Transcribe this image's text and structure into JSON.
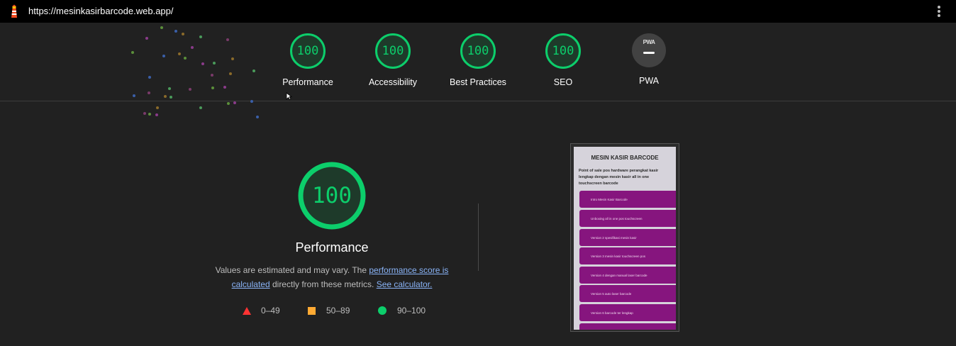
{
  "topbar": {
    "url": "https://mesinkasirbarcode.web.app/",
    "menu_icon": "kebab-menu-icon",
    "logo_icon": "lighthouse-icon"
  },
  "categories": [
    {
      "label": "Performance",
      "score": "100"
    },
    {
      "label": "Accessibility",
      "score": "100"
    },
    {
      "label": "Best Practices",
      "score": "100"
    },
    {
      "label": "SEO",
      "score": "100"
    },
    {
      "label": "PWA",
      "badge": "PWA"
    }
  ],
  "main": {
    "score": "100",
    "title": "Performance",
    "desc_prefix": "Values are estimated and may vary. The ",
    "desc_link1": "performance score is calculated",
    "desc_mid": " directly from these metrics. ",
    "desc_link2": "See calculator."
  },
  "legend": [
    {
      "range": "0–49",
      "shape": "triangle",
      "color": "#ff3333"
    },
    {
      "range": "50–89",
      "shape": "square",
      "color": "#ffaa33"
    },
    {
      "range": "90–100",
      "shape": "circle",
      "color": "#0cce6b"
    }
  ],
  "screenshot": {
    "title": "MESIN KASIR BARCODE",
    "subtitle": "Point of sale pos hardware perangkat kasir lengkap dengan mesin kasir all in one touchscreen barcode",
    "items": [
      "Intro Mesin Kasir Barcode",
      "Unboxing all in one pos touchscreen",
      "Version 2 spesifikasi mesin kasir",
      "Version 3 mesin kasir touchscreen pos",
      "Version 4 dengan manual laser barcode",
      "Version 5 auto laser barcode",
      "Version 6 barcode ter lengkap"
    ]
  },
  "colors": {
    "pass": "#0cce6b",
    "average": "#ffaa33",
    "fail": "#ff3333",
    "item_bg": "#86157e"
  }
}
